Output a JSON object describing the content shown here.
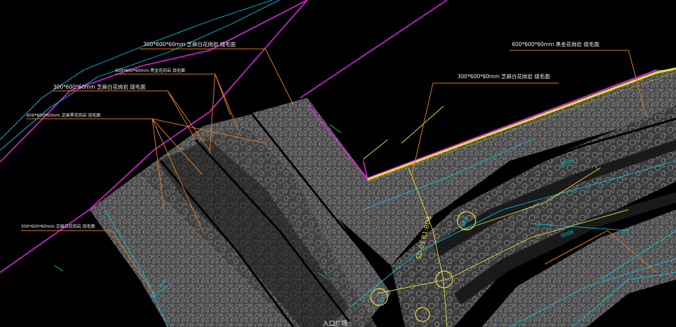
{
  "colors": {
    "background": "#000000",
    "magenta": "#e020e0",
    "cyan": "#00c8e6",
    "orange": "#e07820",
    "yellow": "#e8e03c",
    "green": "#20c040",
    "hatch_fill": "#4a4a4a"
  },
  "annotations": {
    "a1": "300*600*60mm 芝麻白花岗岩 烧毛面",
    "a2": "600*600*60mm 黑金花岗岩 烧毛面",
    "a3": "300*600*60mm 芝麻白花岗岩 烧毛面",
    "a4": "600*600*60mm 芝麻黑花岗岩 烧毛面",
    "a5": "300*600*60mm 芝麻白花岗岩 烧毛面",
    "a6": "600*600*60mm 黑金花岗岩 烧毛面",
    "a7": "300*600*60mm 芝麻白花岗岩 烧毛面"
  },
  "dims": {
    "vertical": "SD-01 R1:BD8"
  },
  "tags": {
    "t1": "SD08",
    "t2": "SD08",
    "t3": "SD06",
    "t4": "SD10"
  },
  "plaza_label": "入口广场"
}
